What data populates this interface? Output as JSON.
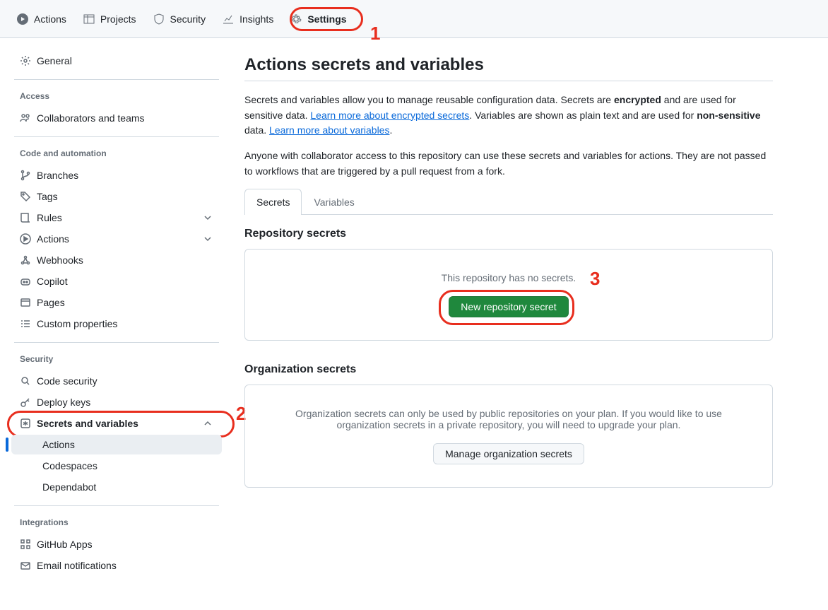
{
  "topnav": {
    "actions": "Actions",
    "projects": "Projects",
    "security": "Security",
    "insights": "Insights",
    "settings": "Settings"
  },
  "annotations": {
    "n1": "1",
    "n2": "2",
    "n3": "3"
  },
  "sidebar": {
    "general": "General",
    "access_title": "Access",
    "collaborators": "Collaborators and teams",
    "code_title": "Code and automation",
    "branches": "Branches",
    "tags": "Tags",
    "rules": "Rules",
    "actions": "Actions",
    "webhooks": "Webhooks",
    "copilot": "Copilot",
    "pages": "Pages",
    "custom_properties": "Custom properties",
    "security_title": "Security",
    "code_security": "Code security",
    "deploy_keys": "Deploy keys",
    "secrets_vars": "Secrets and variables",
    "sub_actions": "Actions",
    "sub_codespaces": "Codespaces",
    "sub_dependabot": "Dependabot",
    "integrations_title": "Integrations",
    "github_apps": "GitHub Apps",
    "email_notifications": "Email notifications"
  },
  "main": {
    "title": "Actions secrets and variables",
    "desc1_a": "Secrets and variables allow you to manage reusable configuration data. Secrets are ",
    "desc1_b": "encrypted",
    "desc1_c": " and are used for sensitive data. ",
    "link1": "Learn more about encrypted secrets",
    "desc1_d": ". Variables are shown as plain text and are used for ",
    "desc1_e": "non-sensitive",
    "desc1_f": " data. ",
    "link2": "Learn more about variables",
    "desc1_g": ".",
    "desc2": "Anyone with collaborator access to this repository can use these secrets and variables for actions. They are not passed to workflows that are triggered by a pull request from a fork.",
    "tab_secrets": "Secrets",
    "tab_variables": "Variables",
    "repo_secrets_heading": "Repository secrets",
    "no_secrets_msg": "This repository has no secrets.",
    "new_secret_btn": "New repository secret",
    "org_secrets_heading": "Organization secrets",
    "org_msg": "Organization secrets can only be used by public repositories on your plan. If you would like to use organization secrets in a private repository, you will need to upgrade your plan.",
    "manage_org_btn": "Manage organization secrets"
  }
}
